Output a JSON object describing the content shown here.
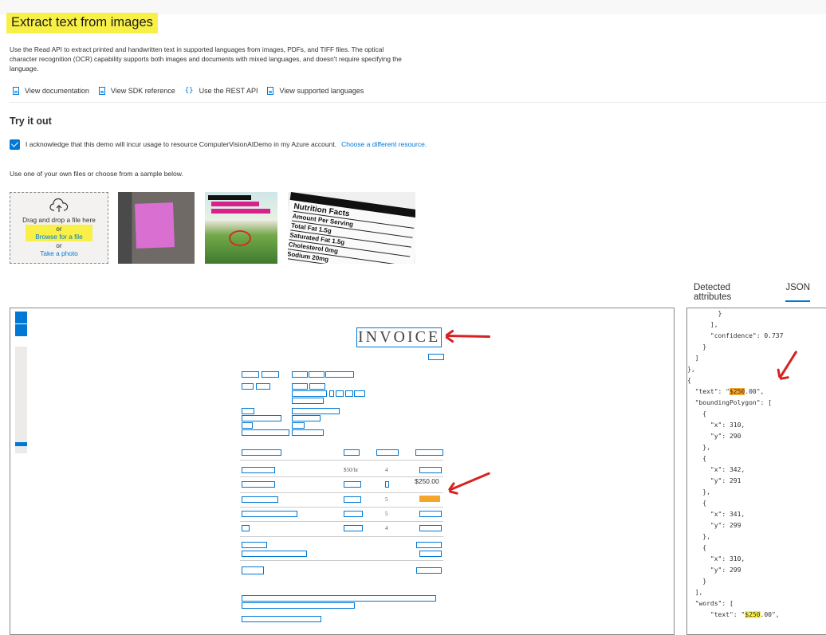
{
  "header": {
    "title": "Extract text from images",
    "description": "Use the Read API to extract printed and handwritten text in supported languages from images, PDFs, and TIFF files. The optical character recognition (OCR) capability supports both images and documents with mixed languages, and doesn't require specifying the language."
  },
  "links": [
    {
      "label": "View documentation",
      "icon": "document-icon"
    },
    {
      "label": "View SDK reference",
      "icon": "document-icon"
    },
    {
      "label": "Use the REST API",
      "icon": "braces-icon"
    },
    {
      "label": "View supported languages",
      "icon": "document-icon"
    }
  ],
  "try_it": {
    "heading": "Try it out",
    "ack_text": "I acknowledge that this demo will incur usage to resource ComputerVisionAIDemo in my Azure account.",
    "ack_checked": true,
    "change_resource": "Choose a different resource.",
    "use_text": "Use one of your own files or choose from a sample below."
  },
  "upload": {
    "drag": "Drag and drop a file here",
    "or1": "or",
    "browse": "Browse for a file",
    "or2": "or",
    "photo": "Take a photo"
  },
  "samples": {
    "nutrition_title": "Nutrition Facts",
    "nutrition_lines": [
      "Amount Per Serving",
      "Total Fat 1.5g",
      "Saturated Fat 1.5g",
      "Cholesterol 0mg",
      "Sodium 20mg"
    ]
  },
  "tabs": {
    "detected": "Detected attributes",
    "json": "JSON"
  },
  "invoice": {
    "heading": "INVOICE",
    "amount_label": "$250.00"
  },
  "json_lines": [
    "        }",
    "      ],",
    "      \"confidence\": 0.737",
    "    }",
    "  ]",
    "},",
    "{",
    "  \"text\": \"",
    "  \"boundingPolygon\": [",
    "    {",
    "      \"x\": 310,",
    "      \"y\": 290",
    "    },",
    "    {",
    "      \"x\": 342,",
    "      \"y\": 291",
    "    },",
    "    {",
    "      \"x\": 341,",
    "      \"y\": 299",
    "    },",
    "    {",
    "      \"x\": 310,",
    "      \"y\": 299",
    "    }",
    "  ],",
    "  \"words\": [",
    "    {",
    "      \"text\": \""
  ],
  "json_text1": {
    "pre": "  \"text\": \"",
    "hl": "$250",
    "post": ".00\","
  },
  "json_text2": {
    "pre": "      \"text\": \"",
    "hl": "$250",
    "post": ".00\","
  },
  "colors": {
    "accent": "#0078d4",
    "highlight": "#f9f047",
    "orange": "#f6a52b",
    "arrow": "#d62222"
  }
}
